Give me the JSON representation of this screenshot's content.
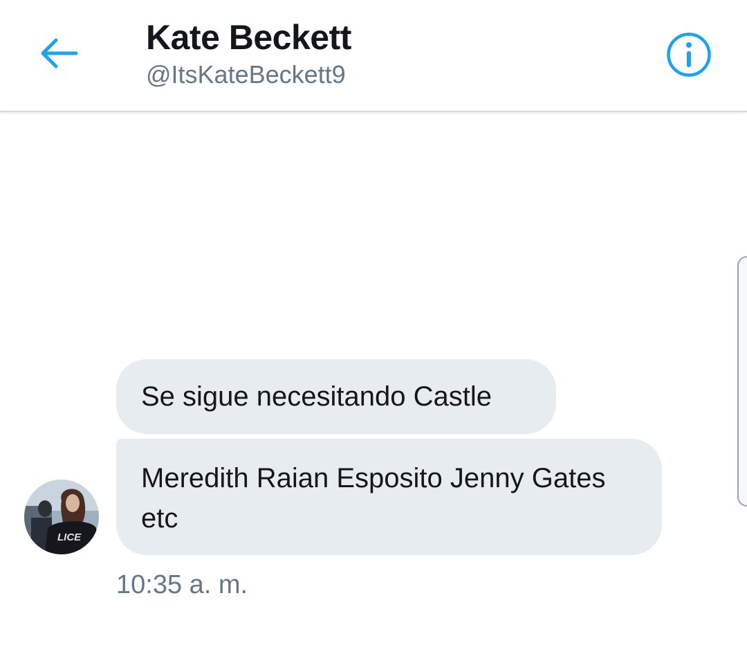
{
  "header": {
    "title": "Kate Beckett",
    "handle": "@ItsKateBeckett9",
    "back_icon": "arrow-left-icon",
    "info_icon": "info-circle-icon"
  },
  "messages": [
    {
      "text": "Se sigue necesitando Castle"
    },
    {
      "text": "Meredith Raian Esposito Jenny Gates etc"
    }
  ],
  "timestamp": "10:35 a. m.",
  "avatar": {
    "badge_text": "LICE"
  },
  "colors": {
    "accent": "#1da1f2",
    "bubble": "#e6ecf0",
    "text_primary": "#14171a",
    "text_secondary": "#657786"
  }
}
